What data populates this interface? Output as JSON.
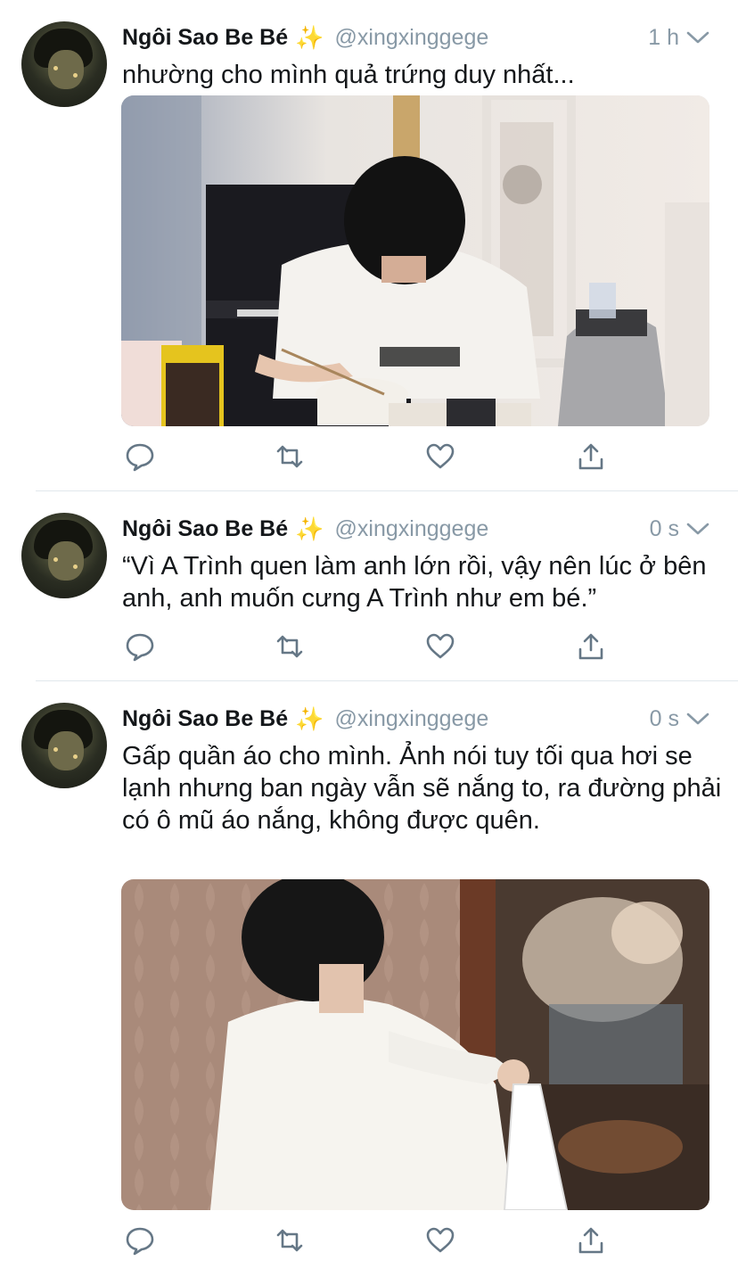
{
  "tweets": [
    {
      "author_name": "Ngôi Sao Be Bé",
      "author_emoji": "✨",
      "handle": "@xingxinggege",
      "time": "1 h",
      "text": "nhường cho mình quả trứng duy nhất...",
      "has_media": true
    },
    {
      "author_name": "Ngôi Sao Be Bé",
      "author_emoji": "✨",
      "handle": "@xingxinggege",
      "time": "0 s",
      "text": "“Vì A Trình quen làm anh lớn rồi, vậy nên lúc ở bên anh, anh muốn cưng A Trình như em bé.”",
      "has_media": false
    },
    {
      "author_name": "Ngôi Sao Be Bé",
      "author_emoji": "✨",
      "handle": "@xingxinggege",
      "time": "0 s",
      "text": "Gấp quần áo cho mình. Ảnh nói tuy tối qua hơi se lạnh nhưng ban ngày vẫn sẽ nắng to, ra đường phải có ô mũ áo nắng, không được quên.",
      "has_media": true
    }
  ],
  "icons": {
    "reply": "speech-bubble-icon",
    "retweet": "retweet-arrows-icon",
    "like": "heart-outline-icon",
    "share": "share-upload-icon",
    "more": "chevron-down-icon"
  },
  "colors": {
    "text_primary": "#14171a",
    "text_secondary": "#8899a6",
    "icon": "#657786",
    "divider": "#e1e8ed"
  }
}
